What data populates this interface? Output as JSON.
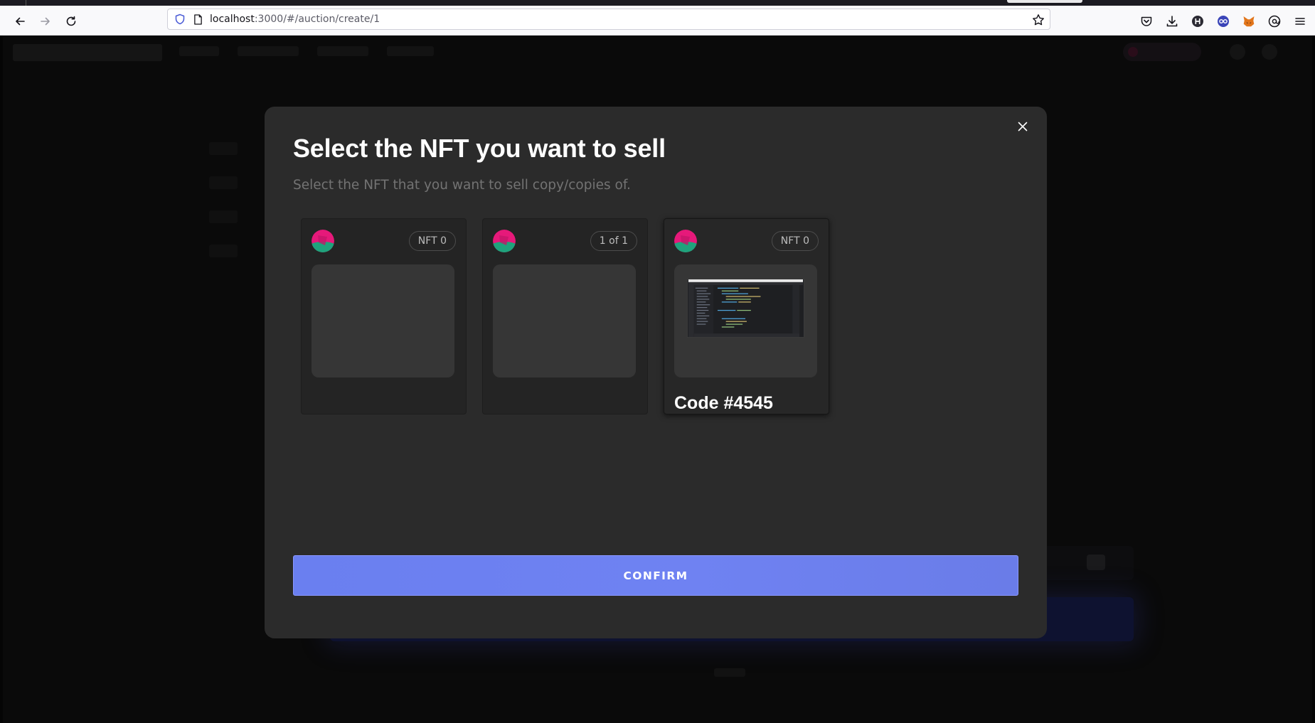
{
  "browser": {
    "url_host": "localhost",
    "url_path": ":3000/#/auction/create/1",
    "extensions": [
      "pocket-icon",
      "download-icon",
      "h-extension-icon",
      "extension-icon",
      "metamask-icon",
      "account-icon",
      "menu-icon"
    ]
  },
  "modal": {
    "title": "Select the NFT you want to sell",
    "subtitle": "Select the NFT that you want to sell copy/copies of.",
    "confirm_label": "CONFIRM"
  },
  "cards": [
    {
      "badge": "NFT 0",
      "name": "",
      "has_image": false
    },
    {
      "badge": "1 of 1",
      "name": "",
      "has_image": false
    },
    {
      "badge": "NFT 0",
      "name": "Code #4545",
      "has_image": true
    }
  ],
  "colors": {
    "avatar_pink": "#e6197a",
    "avatar_green": "#1fa37c",
    "confirm_bg": "#6c80f1",
    "modal_bg": "#2b2b2b"
  }
}
